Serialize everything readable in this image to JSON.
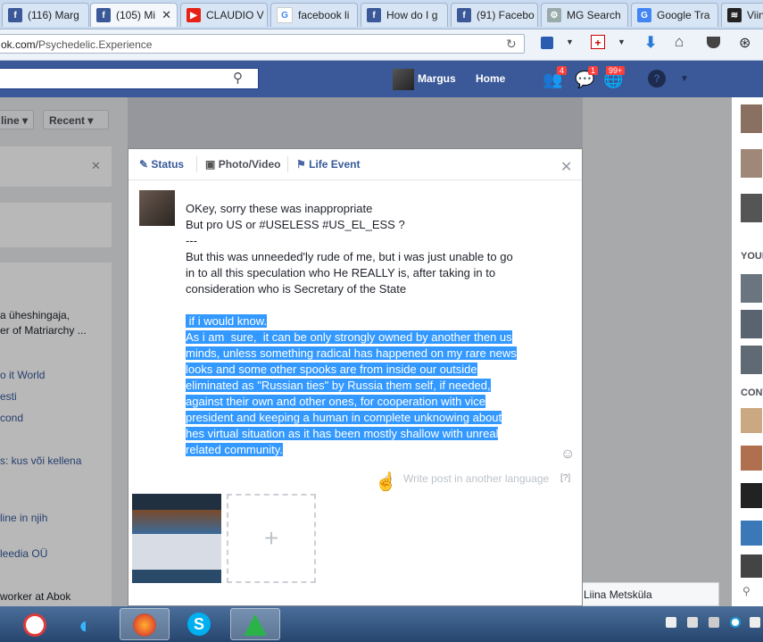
{
  "browser": {
    "tabs": [
      {
        "label": "(116) Marg",
        "icon": "facebook-icon"
      },
      {
        "label": "(105) Mi",
        "icon": "facebook-icon"
      },
      {
        "label": "CLAUDIO V",
        "icon": "youtube-icon"
      },
      {
        "label": "facebook li",
        "icon": "google-icon"
      },
      {
        "label": "How do I g",
        "icon": "facebook-icon"
      },
      {
        "label": "(91) Facebo",
        "icon": "facebook-icon"
      },
      {
        "label": "MG Search",
        "icon": "search-engine-icon"
      },
      {
        "label": "Google Tra",
        "icon": "google-translate-icon"
      },
      {
        "label": "Viin",
        "icon": "site-icon"
      }
    ],
    "url_domain": "ok.com/",
    "url_path": "Psychedelic.Experience"
  },
  "fb_header": {
    "user_name": "Margus",
    "home_label": "Home",
    "badges": {
      "friends": "4",
      "messages": "1",
      "notifications": "99+"
    }
  },
  "page": {
    "filter_online": "line",
    "filter_recent": "Recent",
    "left_items": [
      "a üheshingaja,",
      "er of Matriarchy ...",
      "o it World",
      "esti",
      "cond",
      "s: kus või kellena",
      "line in njih",
      "leedia OÜ",
      "worker at Abok"
    ],
    "right_labels": [
      "YOUR",
      "CONT"
    ],
    "chat_name": "Liina Metsküla"
  },
  "composer": {
    "tabs": {
      "status": "Status",
      "photo": "Photo/Video",
      "life": "Life Event"
    },
    "post_lines": [
      "OKey, sorry these was inappropriate",
      "But pro US or #USELESS #US_EL_ESS ?",
      "---",
      "But this was unneeded'ly rude of me, but i was just unable to go",
      "in to all this speculation who He REALLY is, after taking in to",
      "consideration who is Secretary of the State"
    ],
    "selected_lines": [
      " if i would know.",
      "As i am  sure,  it can be only strongly owned by another then us",
      "minds, unless something radical has happened on my rare news",
      "looks and some other spooks are from inside our outside",
      "eliminated as \"Russian ties\" by Russia them self, if needed,",
      "against their own and other ones, for cooperation with vice",
      "president and keeping a human in complete unknowing about",
      "hes virtual situation as it has been mostly shallow with unreal",
      "related community."
    ],
    "translate_label": "Write post in another language",
    "help_label": "[?]",
    "add_photo_label": "+"
  }
}
